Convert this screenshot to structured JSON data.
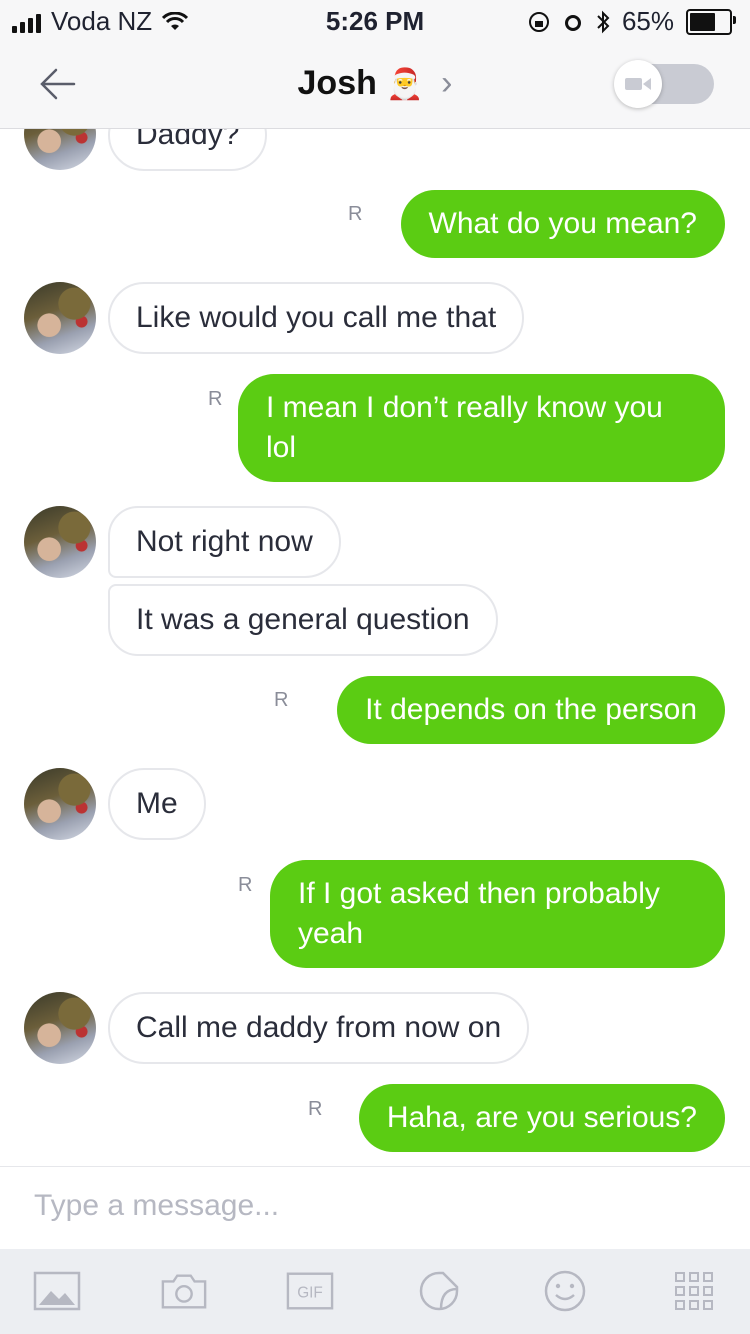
{
  "status_bar": {
    "carrier": "Voda NZ",
    "time": "5:26 PM",
    "battery": "65%"
  },
  "nav": {
    "contact_name": "Josh",
    "contact_emoji": "🎅",
    "chevron": "›"
  },
  "messages": [
    {
      "side": "in",
      "text": "Daddy?"
    },
    {
      "side": "out",
      "text": "What do you mean?",
      "receipt": "R"
    },
    {
      "side": "in",
      "text": "Like would you call me that"
    },
    {
      "side": "out",
      "text": "I mean I don’t really know you lol",
      "receipt": "R"
    },
    {
      "side": "in",
      "text": "Not right now"
    },
    {
      "side": "in",
      "text": "It was a general question"
    },
    {
      "side": "out",
      "text": "It depends on the person",
      "receipt": "R"
    },
    {
      "side": "in",
      "text": "Me"
    },
    {
      "side": "out",
      "text": "If I got asked then probably yeah",
      "receipt": "R"
    },
    {
      "side": "in",
      "text": "Call me daddy from now on"
    },
    {
      "side": "out",
      "text": "Haha, are you serious?",
      "receipt": "R"
    }
  ],
  "composer": {
    "placeholder": "Type a message..."
  },
  "toolbar": {
    "gif_label": "GIF",
    "icons": [
      "gallery-icon",
      "camera-icon",
      "gif-icon",
      "sticker-icon",
      "smiley-icon",
      "more-grid-icon"
    ]
  },
  "colors": {
    "outgoing_bubble": "#5bcc13",
    "incoming_border": "#e6e7eb",
    "toolbar_bg": "#eceef2"
  }
}
